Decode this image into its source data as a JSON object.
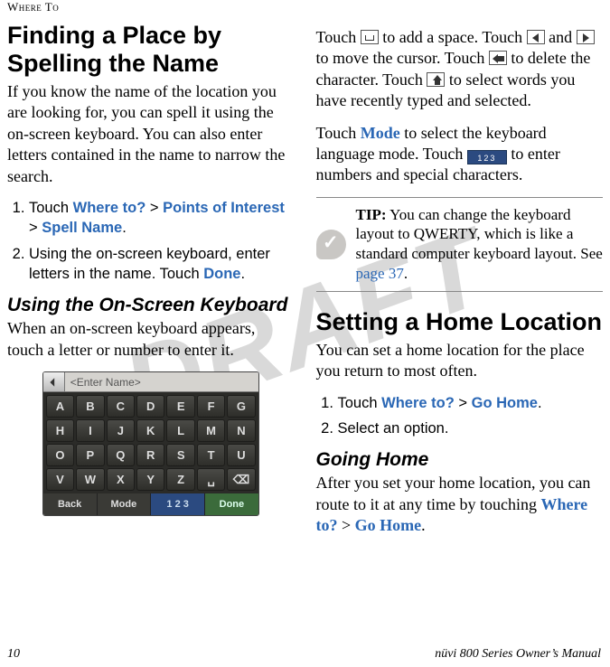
{
  "running_header": "Where To",
  "watermark": "DRAFT",
  "left": {
    "title": "Finding a Place by Spelling the Name",
    "intro": "If you know the name of the location you are looking for, you can spell it using the on-screen keyboard. You can also enter letters contained in the name to narrow the search.",
    "steps": {
      "s1_pre": "Touch ",
      "s1_l1": "Where to?",
      "s1_gt1": " > ",
      "s1_l2": "Points of Interest",
      "s1_gt2": " > ",
      "s1_l3": "Spell Name",
      "s1_post": ".",
      "s2_pre": "Using the on-screen keyboard, enter letters in the name. Touch ",
      "s2_l1": "Done",
      "s2_post": "."
    },
    "subhead": "Using the On-Screen Keyboard",
    "sub_body": "When an on-screen keyboard appears, touch a letter or number to enter it.",
    "keyboard": {
      "placeholder": "<Enter Name>",
      "rows": [
        [
          "A",
          "B",
          "C",
          "D",
          "E",
          "F",
          "G"
        ],
        [
          "H",
          "I",
          "J",
          "K",
          "L",
          "M",
          "N"
        ],
        [
          "O",
          "P",
          "Q",
          "R",
          "S",
          "T",
          "U"
        ],
        [
          "V",
          "W",
          "X",
          "Y",
          "Z",
          "␣",
          "⌫"
        ]
      ],
      "btn_back": "Back",
      "btn_mode": "Mode",
      "btn_123": "1 2 3",
      "btn_done": "Done"
    }
  },
  "right": {
    "para1_a": "Touch ",
    "para1_b": " to add a space. Touch ",
    "para1_c": " and ",
    "para1_d": " to move the cursor. Touch ",
    "para1_e": " to delete the character. Touch ",
    "para1_f": " to select words you have recently typed and selected.",
    "para2_a": "Touch ",
    "para2_mode": "Mode",
    "para2_b": " to select the keyboard language mode. Touch ",
    "para2_c": " to enter numbers and special characters.",
    "tip_lead": "TIP:",
    "tip_body": " You can change the keyboard layout to QWERTY, which is like a standard computer keyboard layout. See ",
    "tip_link": "page 37",
    "tip_end": ".",
    "title2": "Setting a Home Location",
    "body2": "You can set a home location for the place you return to most often.",
    "steps2": {
      "s1_pre": "Touch ",
      "s1_l1": "Where to?",
      "s1_gt": " > ",
      "s1_l2": "Go Home",
      "s1_post": ".",
      "s2": "Select an option."
    },
    "subhead2": "Going Home",
    "subbody2_a": "After you set your home location, you can route to it at any time by touching ",
    "subbody2_l1": "Where to?",
    "subbody2_gt": " > ",
    "subbody2_l2": "Go Home",
    "subbody2_end": "."
  },
  "footer": {
    "page": "10",
    "manual": "nüvi 800 Series Owner’s Manual"
  }
}
